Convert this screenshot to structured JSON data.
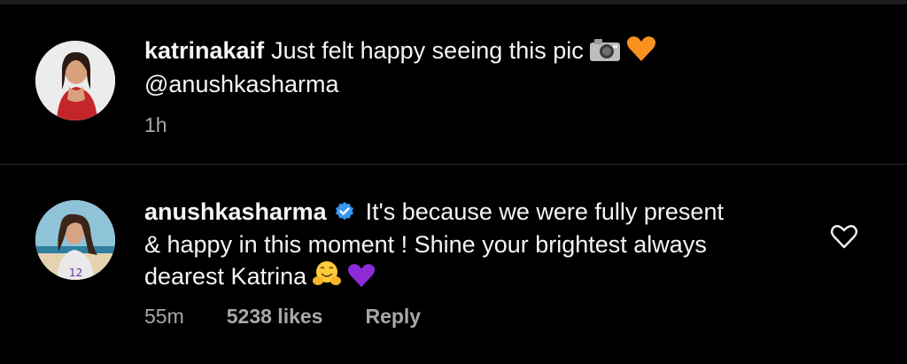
{
  "comments": [
    {
      "username": "katrinakaif",
      "text_line1": "Just felt happy seeing this pic",
      "text_line2": "@anushkasharma",
      "time": "1h",
      "emojis": [
        "camera-emoji",
        "orange-heart-emoji"
      ]
    },
    {
      "username": "anushkasharma",
      "verified": true,
      "text_line1": "It's because we were fully present",
      "text_line2": "& happy in this moment ! Shine your brightest always",
      "text_line3": "dearest Katrina",
      "time": "55m",
      "likes": "5238 likes",
      "reply": "Reply",
      "emojis": [
        "hugging-face-emoji",
        "purple-heart-emoji"
      ]
    }
  ],
  "colors": {
    "background": "#000000",
    "text": "#f5f5f5",
    "meta": "#a8a8a8",
    "verified": "#3897f0",
    "orange_heart": "#f7931e",
    "purple_heart": "#8e2bd6"
  },
  "icons": {
    "like": "heart-outline-icon",
    "verified": "verified-badge-icon"
  }
}
